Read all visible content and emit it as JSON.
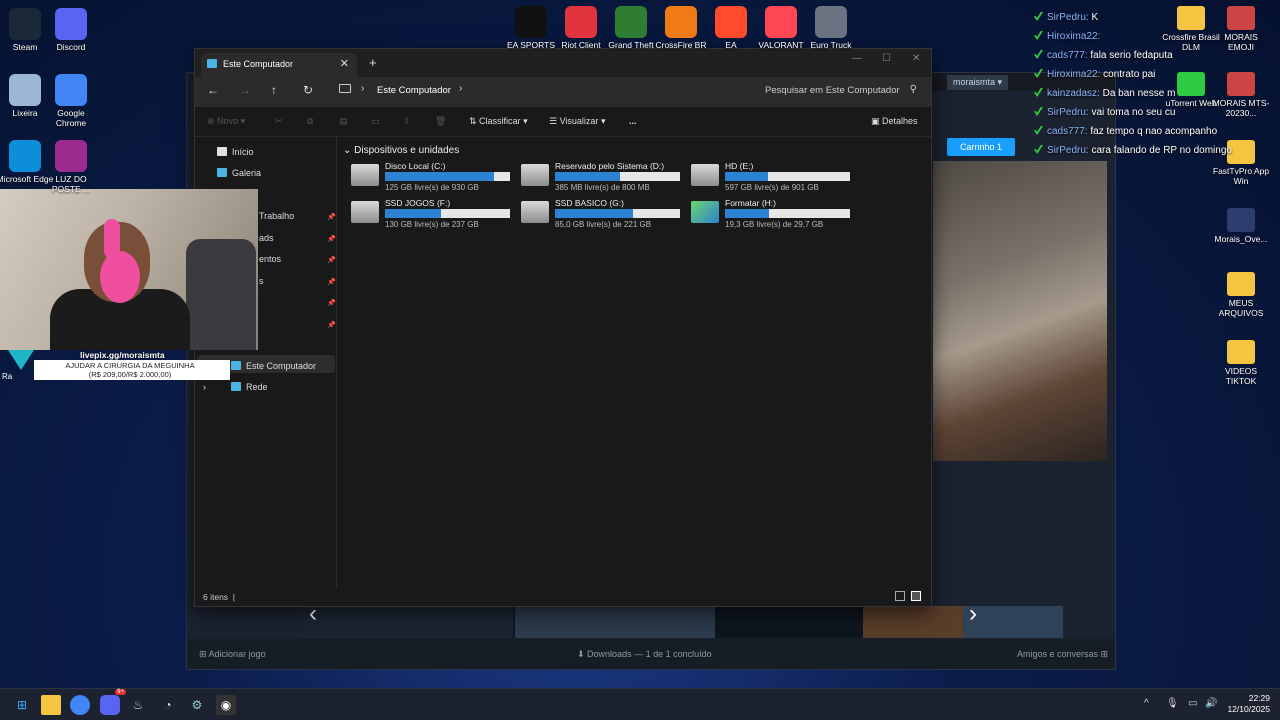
{
  "desktop_left": [
    {
      "label": "Steam",
      "icon": "steam-icon",
      "color": "#1b2838"
    },
    {
      "label": "Discord",
      "icon": "discord-icon",
      "color": "#5865f2"
    },
    {
      "label": "Lixeira",
      "icon": "recycle-bin-icon",
      "color": "#9bb7d4"
    },
    {
      "label": "Google Chrome",
      "icon": "chrome-icon",
      "color": "#4285f4"
    },
    {
      "label": "Microsoft Edge",
      "icon": "edge-icon",
      "color": "#0c8fd8"
    },
    {
      "label": "LUZ DO POSTE ...",
      "icon": "winrar-icon",
      "color": "#9b2c8e"
    }
  ],
  "desktop_top": [
    {
      "label": "EA SPORTS",
      "icon": "ea-sports-icon",
      "color": "#111111"
    },
    {
      "label": "Riot Client",
      "icon": "riot-client-icon",
      "color": "#e1343e"
    },
    {
      "label": "Grand Theft",
      "icon": "gta-icon",
      "color": "#2e7d32"
    },
    {
      "label": "CrossFire BR",
      "icon": "crossfire-icon",
      "color": "#f07a14"
    },
    {
      "label": "EA",
      "icon": "ea-icon",
      "color": "#ff4b2b"
    },
    {
      "label": "VALORANT",
      "icon": "valorant-icon",
      "color": "#ff4655"
    },
    {
      "label": "Euro Truck",
      "icon": "euro-truck-icon",
      "color": "#6b7280"
    }
  ],
  "desktop_right": [
    {
      "label": "Crossfire Brasil DLM",
      "icon": "folder-icon",
      "color": "#f5c542"
    },
    {
      "label": "MORAIS EMOJI",
      "icon": "folder-image-icon",
      "color": "#c44"
    },
    {
      "label": "uTorrent Web",
      "icon": "utorrent-icon",
      "color": "#2ecc40"
    },
    {
      "label": "MORAIS MTS-20230...",
      "icon": "folder-image-icon",
      "color": "#c44"
    },
    {
      "label": "FastTvPro App Win",
      "icon": "folder-icon",
      "color": "#f5c542"
    },
    {
      "label": "Morais_Ove...",
      "icon": "document-icon",
      "color": "#2c3e6e"
    },
    {
      "label": "MEUS ARQUIVOS",
      "icon": "folder-icon",
      "color": "#f5c542"
    },
    {
      "label": "VIDEOS TIKTOK",
      "icon": "folder-icon",
      "color": "#f5c542"
    }
  ],
  "chat": [
    {
      "user": "SirPedru:",
      "msg": "K"
    },
    {
      "user": "Hiroxima22:",
      "msg": ""
    },
    {
      "user": "cads777:",
      "msg": "fala serio fedaputa"
    },
    {
      "user": "Hiroxima22:",
      "msg": "contrato pai"
    },
    {
      "user": "kainzadasz:",
      "msg": "Da ban nesse m"
    },
    {
      "user": "SirPedru:",
      "msg": "vai toma no seu cu"
    },
    {
      "user": "cads777:",
      "msg": "faz tempo q nao acompanho"
    },
    {
      "user": "SirPedru:",
      "msg": "cara falando de RP no domingo"
    }
  ],
  "overlay": {
    "livepix_url": "livepix.gg/moraismta",
    "goal_line1": "AJUDAR A CIRURGIA DA MEGUINHA",
    "goal_line2": "(R$ 209,00/R$ 2.000,00)",
    "partial_left": "Ra"
  },
  "steam": {
    "username": "moraismta",
    "cart": "Carrinho 1",
    "add_game": "Adicionar jogo",
    "downloads": "Downloads — 1 de 1 concluído",
    "friends": "Amigos e conversas"
  },
  "explorer": {
    "tab_title": "Este Computador",
    "breadcrumb": "Este Computador",
    "search_placeholder": "Pesquisar em Este Computador",
    "cmd": {
      "new": "Novo",
      "sort": "Classificar",
      "view": "Visualizar",
      "details": "Detalhes",
      "more": "..."
    },
    "sidebar": [
      {
        "label": "Início",
        "pinned": false
      },
      {
        "label": "Galeria",
        "pinned": false
      },
      {
        "label": "Trabalho",
        "pinned": true
      },
      {
        "label": "ads",
        "pinned": true
      },
      {
        "label": "entos",
        "pinned": true
      },
      {
        "label": "s",
        "pinned": true
      },
      {
        "label": "",
        "pinned": true
      },
      {
        "label": "",
        "pinned": true
      },
      {
        "label": "Este Computador",
        "pinned": false
      },
      {
        "label": "Rede",
        "pinned": false
      }
    ],
    "section_title": "Dispositivos e unidades",
    "drives": [
      {
        "name": "Disco Local (C:)",
        "free": "125 GB livre(s) de 930 GB",
        "used": 0.87,
        "icon": "windows-drive-icon"
      },
      {
        "name": "Reservado pelo Sistema (D:)",
        "free": "385 MB livre(s) de 800 MB",
        "used": 0.52,
        "icon": "drive-icon"
      },
      {
        "name": "HD (E:)",
        "free": "597 GB livre(s) de 901 GB",
        "used": 0.34,
        "icon": "lock-drive-icon"
      },
      {
        "name": "SSD JOGOS (F:)",
        "free": "130 GB livre(s) de 237 GB",
        "used": 0.45,
        "icon": "lock-drive-icon"
      },
      {
        "name": "SSD BASICO (G:)",
        "free": "85,0 GB livre(s) de 221 GB",
        "used": 0.62,
        "icon": "lock-drive-icon"
      },
      {
        "name": "Formatar (H:)",
        "free": "19,3 GB livre(s) de 29,7 GB",
        "used": 0.35,
        "icon": "usb-drive-icon"
      }
    ],
    "status": "6 itens"
  },
  "taskbar": {
    "time": "22:29",
    "date": "12/10/2025",
    "discord_badge": "9+"
  }
}
